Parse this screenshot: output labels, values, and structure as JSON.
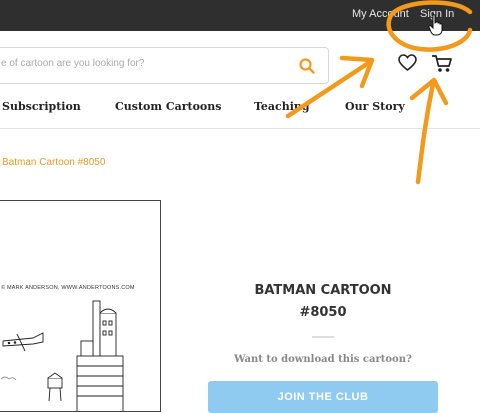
{
  "topbar": {
    "my_account": "My Account",
    "sign_in": "Sign In"
  },
  "search": {
    "placeholder": "e of cartoon are you looking for?"
  },
  "nav": {
    "items": [
      "Subscription",
      "Custom Cartoons",
      "Teaching",
      "Our Story"
    ]
  },
  "breadcrumb": {
    "current": "Batman Cartoon #8050"
  },
  "cartoon": {
    "credit": "© MARK ANDERSON, WWW.ANDERTOONS.COM"
  },
  "product": {
    "title_line1": "BATMAN CARTOON",
    "title_line2": "#8050",
    "download_question": "Want to download this cartoon?",
    "join_label": "JOIN THE CLUB"
  },
  "colors": {
    "accent": "#f39a1d",
    "topbar": "#2f2f2f",
    "join_button": "#8fcbf0",
    "breadcrumb": "#e89a28"
  },
  "icons": [
    "search-icon",
    "heart-icon",
    "cart-icon",
    "cursor-icon"
  ]
}
